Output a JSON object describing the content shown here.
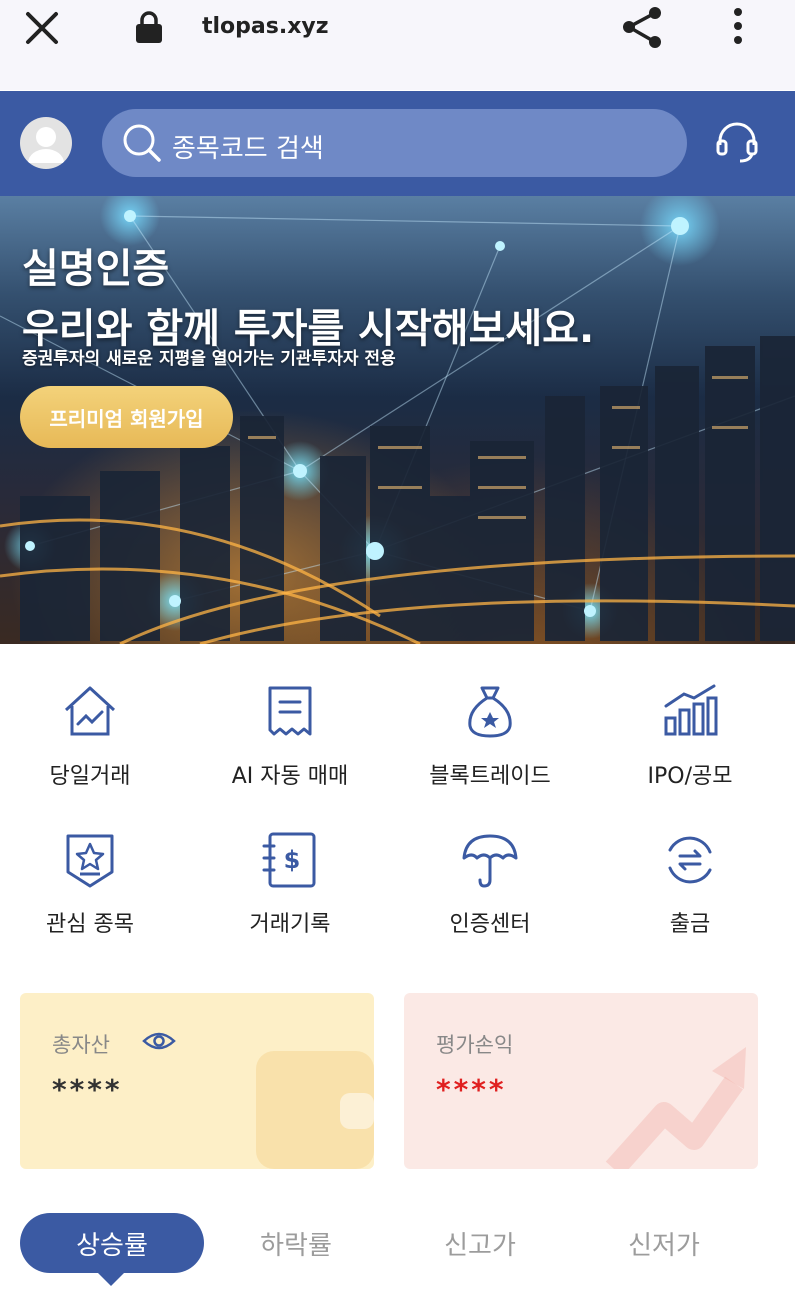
{
  "browser": {
    "url": "tlopas.xyz",
    "icons": [
      "close-icon",
      "lock-icon",
      "share-icon",
      "more-vertical-icon"
    ]
  },
  "header": {
    "search_placeholder": "종목코드 검색",
    "icons": [
      "avatar",
      "search-icon",
      "headset-icon"
    ],
    "brand_color": "#3b5aa3"
  },
  "hero": {
    "title_line1": "실명인증",
    "title_line2": "우리와 함께 투자를 시작해보세요.",
    "subtitle": "증권투자의 새로운 지평을 열어가는 기관투자자 전용",
    "cta_label": "프리미엄 회원가입"
  },
  "menu": {
    "items": [
      {
        "label": "당일거래",
        "icon": "house-chart-icon"
      },
      {
        "label": "AI 자동 매매",
        "icon": "receipt-icon"
      },
      {
        "label": "블록트레이드",
        "icon": "money-bag-icon"
      },
      {
        "label": "IPO/공모",
        "icon": "bar-chart-icon"
      },
      {
        "label": "관심 종목",
        "icon": "star-badge-icon"
      },
      {
        "label": "거래기록",
        "icon": "ledger-dollar-icon"
      },
      {
        "label": "인증센터",
        "icon": "umbrella-icon"
      },
      {
        "label": "출금",
        "icon": "exchange-icon"
      }
    ]
  },
  "assets": {
    "total": {
      "title": "총자산",
      "value": "****",
      "icon": "eye-icon"
    },
    "profit": {
      "title": "평가손익",
      "value": "****",
      "value_color": "#e02020"
    }
  },
  "tabs": {
    "items": [
      "상승률",
      "하락률",
      "신고가",
      "신저가"
    ],
    "active_index": 0
  }
}
